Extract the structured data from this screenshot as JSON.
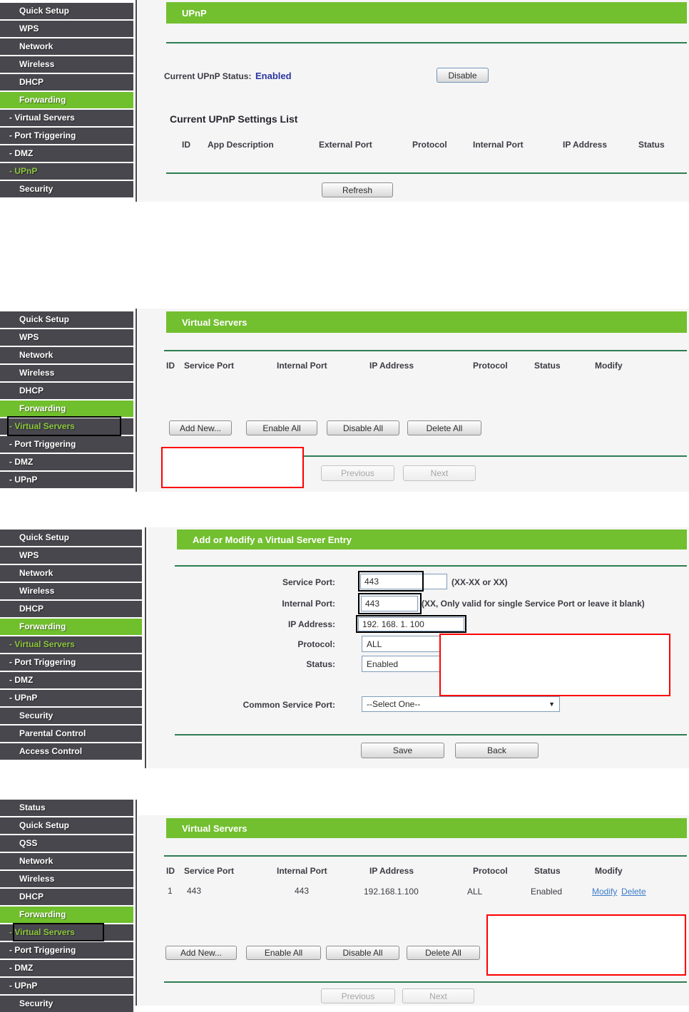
{
  "colors": {
    "accent_green": "#70bf2c",
    "header_green": "#72bf2f",
    "line_green": "#2e7d52",
    "sidebar_gray": "#47474d",
    "annotation_red": "#ff0000",
    "annotation_black": "#000000",
    "status_blue": "#2b35a0",
    "link_blue": "#3d7cc9"
  },
  "icons": {
    "dropdown_arrow": "▼"
  },
  "s1": {
    "sidebar": [
      "Quick Setup",
      "WPS",
      "Network",
      "Wireless",
      "DHCP",
      "Forwarding",
      "- Virtual Servers",
      "- Port Triggering",
      "- DMZ",
      "- UPnP",
      "Security"
    ],
    "header": "UPnP",
    "status_label": "Current UPnP Status:",
    "status_value": "Enabled",
    "disable_button": "Disable",
    "list_title": "Current UPnP Settings List",
    "columns": [
      "ID",
      "App Description",
      "External Port",
      "Protocol",
      "Internal Port",
      "IP Address",
      "Status"
    ],
    "refresh_button": "Refresh"
  },
  "s2": {
    "sidebar": [
      "Quick Setup",
      "WPS",
      "Network",
      "Wireless",
      "DHCP",
      "Forwarding",
      "- Virtual Servers",
      "- Port Triggering",
      "- DMZ",
      "- UPnP"
    ],
    "header": "Virtual Servers",
    "columns": [
      "ID",
      "Service Port",
      "Internal Port",
      "IP Address",
      "Protocol",
      "Status",
      "Modify"
    ],
    "buttons": [
      "Add New...",
      "Enable All",
      "Disable All",
      "Delete All"
    ],
    "pager": [
      "Previous",
      "Next"
    ]
  },
  "s3": {
    "sidebar": [
      "Quick Setup",
      "WPS",
      "Network",
      "Wireless",
      "DHCP",
      "Forwarding",
      "- Virtual Servers",
      "- Port Triggering",
      "- DMZ",
      "- UPnP",
      "Security",
      "Parental Control",
      "Access Control"
    ],
    "header": "Add or Modify a Virtual Server Entry",
    "fields": {
      "service_port": {
        "label": "Service Port:",
        "value": "443",
        "hint": "(XX-XX or XX)"
      },
      "internal_port": {
        "label": "Internal Port:",
        "value": "443",
        "hint": "(XX, Only valid for single Service Port or leave it blank)"
      },
      "ip_address": {
        "label": "IP Address:",
        "value": "192. 168. 1. 100"
      },
      "protocol": {
        "label": "Protocol:",
        "value": "ALL"
      },
      "status": {
        "label": "Status:",
        "value": "Enabled"
      },
      "common_service_port": {
        "label": "Common Service Port:",
        "value": "--Select One--"
      }
    },
    "save_button": "Save",
    "back_button": "Back"
  },
  "s4": {
    "sidebar": [
      "Status",
      "Quick Setup",
      "QSS",
      "Network",
      "Wireless",
      "DHCP",
      "Forwarding",
      "- Virtual Servers",
      "- Port Triggering",
      "- DMZ",
      "- UPnP",
      "Security"
    ],
    "header": "Virtual Servers",
    "columns": [
      "ID",
      "Service Port",
      "Internal Port",
      "IP Address",
      "Protocol",
      "Status",
      "Modify"
    ],
    "row": [
      "1",
      "443",
      "443",
      "192.168.1.100",
      "ALL",
      "Enabled"
    ],
    "modify_link": "Modify",
    "delete_link": "Delete",
    "buttons": [
      "Add New...",
      "Enable All",
      "Disable All",
      "Delete All"
    ],
    "pager": [
      "Previous",
      "Next"
    ]
  }
}
